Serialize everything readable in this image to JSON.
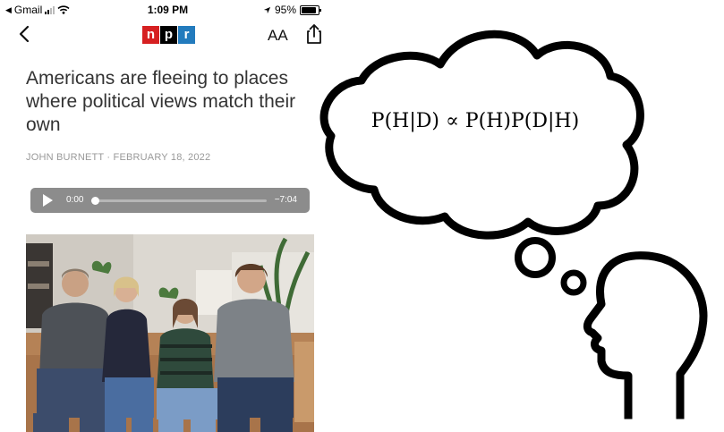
{
  "status_bar": {
    "carrier": "Gmail",
    "time": "1:09 PM",
    "battery": "95%"
  },
  "nav": {
    "logo_letters": [
      "n",
      "p",
      "r"
    ],
    "logo_colors": [
      "#d62021",
      "#000000",
      "#237bbd"
    ],
    "text_size_label": "AA"
  },
  "article": {
    "headline": "Americans are fleeing to places where political views match their own",
    "byline": "JOHN BURNETT · FEBRUARY 18, 2022"
  },
  "audio": {
    "elapsed": "0:00",
    "remaining": "−7:04",
    "progress": 0.0
  },
  "illustration": {
    "formula": "P(H|D) ∝ P(H)P(D|H)"
  }
}
